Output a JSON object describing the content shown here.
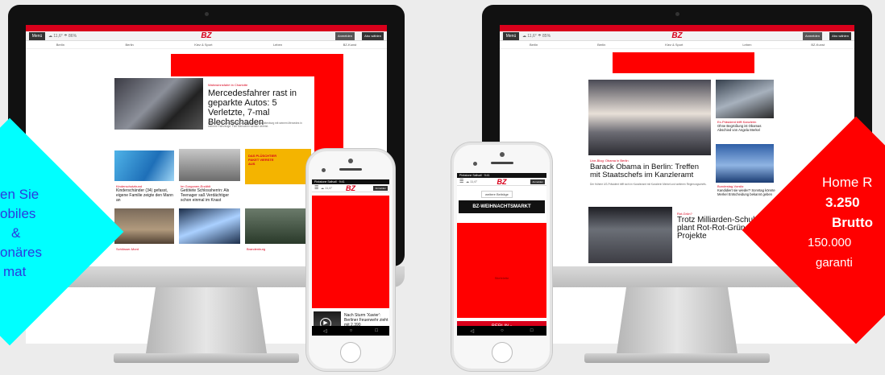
{
  "left_monitor": {
    "menu_label": "Menü",
    "weather": "☁ 11,6° ☂ 86%",
    "logo": "BZ",
    "nav": [
      "Berlin",
      "Berlin",
      "Kiez & Sport",
      "Leben",
      "BZ-Kunst"
    ],
    "account_a": "Anmelden",
    "account_b": "Abo wählen",
    "lead_kicker": "Wahnsinnsfahrt in Charlotte",
    "lead_headline": "Mercedesfahrer rast in geparkte Autos: 5 Verletzte, 7-mal Blechschaden",
    "lead_teaser": "Gegen 3 Uhr nachts rast ein 24-Jähriger in Charlottenburg mit seinem Mercedes in mehrere Fahrzeuge. Fünf Menschen werden verletzt.",
    "story_2_kicker": "Kinderschutzbund",
    "story_2_headline": "Kinderschänder (34) gefasst, eigene Familie zeigte den Mann an",
    "story_3_kicker": "Im Gorgonen-Erzählt",
    "story_3_headline": "Getötete Schlossherrin: Als Teenager saß Verdächtiger schon einmal im Knast",
    "ad_text": "DAS PLÜSCHTIER PAKET VIERSTE AUS",
    "bottom_kicker_a": "Schlösser-Mord",
    "bottom_kicker_b": "Brandenburg"
  },
  "left_phone": {
    "status": "Pinkstone Saltvall · 9:41",
    "weather": "☁ 11,6°",
    "logo": "BZ",
    "account": "Anmelden",
    "story_headline": "Nach Sturm 'Xavier': Berliner Feuerwehr zieht mit 2.390",
    "nav_back": "◁",
    "nav_home": "○",
    "nav_recent": "□"
  },
  "right_phone": {
    "status": "Pinkstone Saltvall · 9:41",
    "weather": "☁ 11,6°",
    "logo": "BZ",
    "account": "Anmelden",
    "tag": "weitere Beiträge",
    "banner": "BZ-WEIHNACHTSMARKT",
    "ad_caption": "Stiefelette",
    "cta_label": "BERLIN ›",
    "nav_back": "◁",
    "nav_home": "○",
    "nav_recent": "□"
  },
  "right_monitor": {
    "menu_label": "Menü",
    "weather": "☁ 11,6° ☂ 85%",
    "logo": "BZ",
    "nav": [
      "Berlin",
      "Berlin",
      "Kiez & Sport",
      "Leben",
      "BZ-Kunst"
    ],
    "account_a": "Anmelden",
    "account_b": "Abo wählen",
    "lead_kicker": "Live-Blog: Obama in Berlin",
    "lead_headline": "Barack Obama in Berlin: Treffen mit Staatschefs im Kanzleramt",
    "lead_teaser": "Der frühere US-Präsident trifft sich im Kanzleramt mit Kanzlerin Merkel und weiteren Regierungschefs.",
    "side_1_kicker": "Ex-Präsident trifft Kanzlerin",
    "side_1_headline": "Ohne Begrüßung ist Obamas Abschied von Angela Merkel",
    "side_2_kicker": "Bundestag-Vorsitz",
    "side_2_headline": "Kandidiert sie wieder? Sonntag könnte Merkel Entscheidung bekannt geben",
    "story_3_kicker": "Rot-Grün?",
    "story_3_headline": "Trotz Milliarden-Schulden plant Rot-Rot-Grün Risiko-Projekte"
  },
  "left_diamond": {
    "lines": [
      "en Sie",
      "obiles",
      "&",
      "onäres",
      "mat"
    ]
  },
  "right_diamond": {
    "line_1": "Home R",
    "line_2": "3.250",
    "line_3": "Brutto",
    "line_4": "150.000",
    "line_5": "garanti"
  },
  "colors": {
    "ad_red": "#ff0000",
    "brand_red": "#d9001b",
    "cyan": "#00ffff"
  }
}
